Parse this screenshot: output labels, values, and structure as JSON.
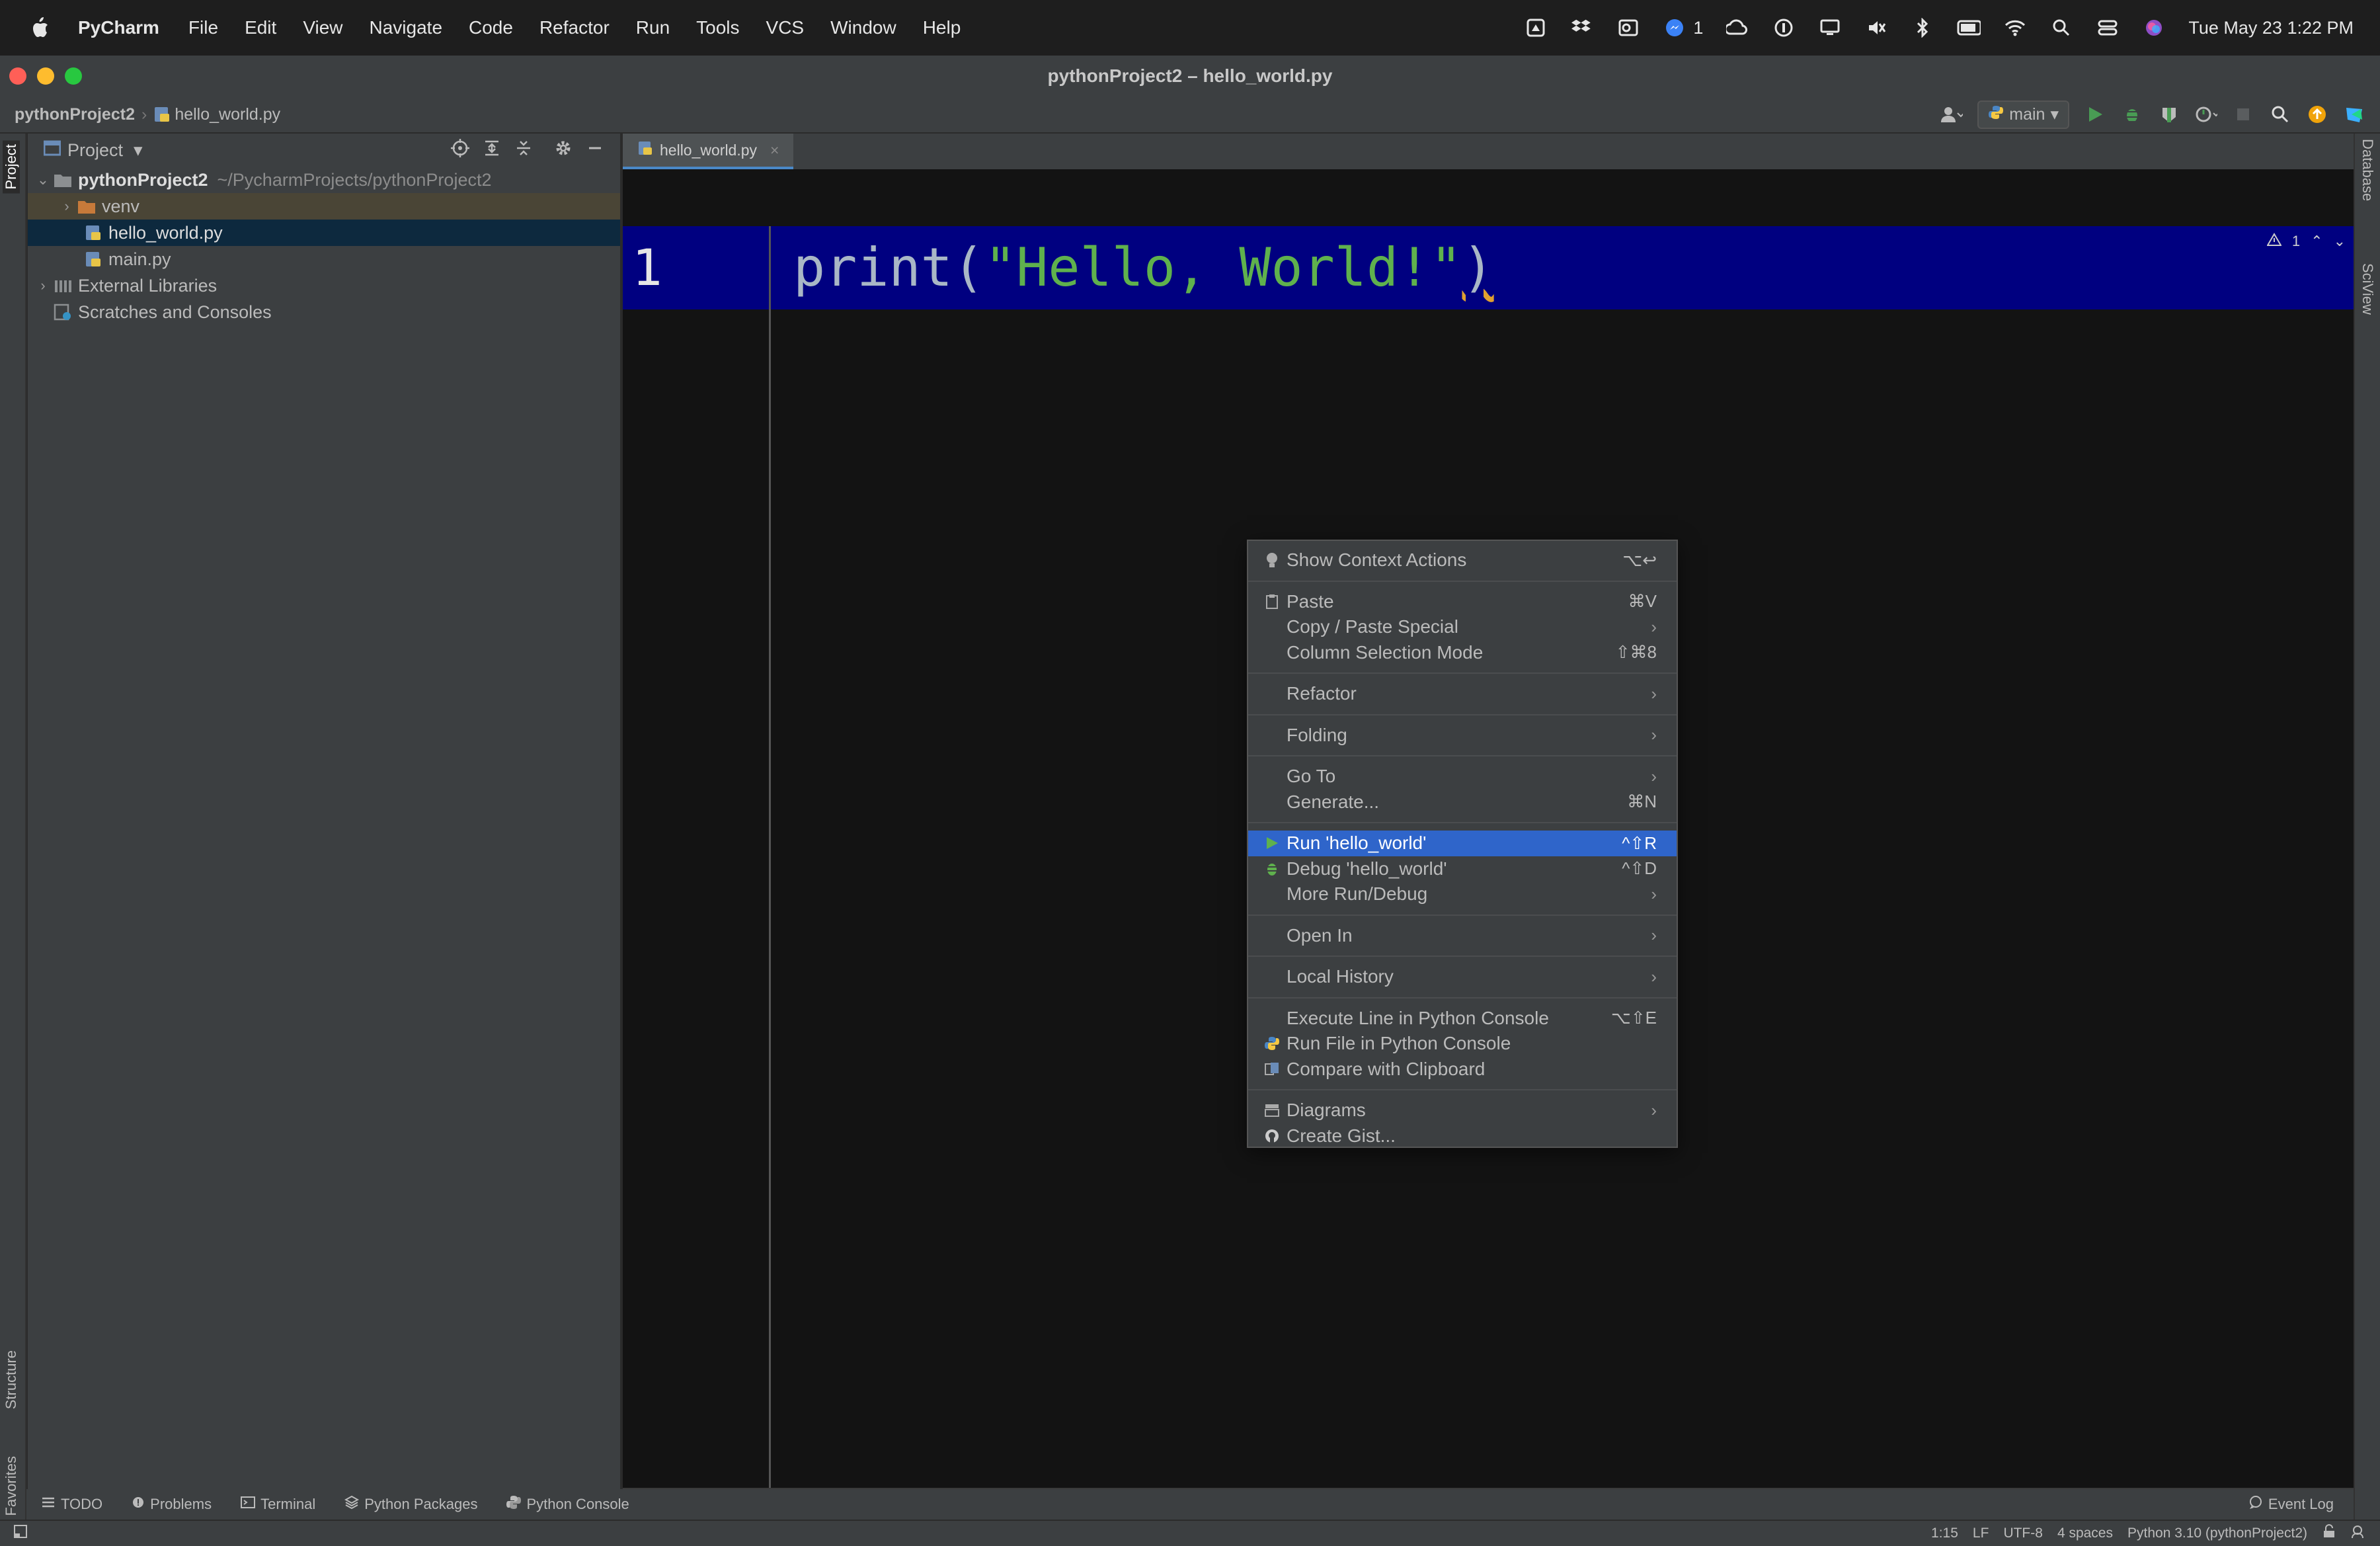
{
  "menubar": {
    "app_name": "PyCharm",
    "items": [
      "File",
      "Edit",
      "View",
      "Navigate",
      "Code",
      "Refactor",
      "Run",
      "Tools",
      "VCS",
      "Window",
      "Help"
    ],
    "notification_count": "1",
    "datetime": "Tue May 23  1:22 PM"
  },
  "window": {
    "title": "pythonProject2 – hello_world.py"
  },
  "navbar": {
    "project": "pythonProject2",
    "file": "hello_world.py",
    "branch": "main"
  },
  "project_panel": {
    "title": "Project",
    "root_name": "pythonProject2",
    "root_path": "~/PycharmProjects/pythonProject2",
    "items": [
      {
        "label": "venv"
      },
      {
        "label": "hello_world.py"
      },
      {
        "label": "main.py"
      },
      {
        "label": "External Libraries"
      },
      {
        "label": "Scratches and Consoles"
      }
    ]
  },
  "left_tabs": {
    "project": "Project",
    "structure": "Structure",
    "favorites": "Favorites"
  },
  "right_tabs": {
    "database": "Database",
    "sciview": "SciView"
  },
  "editor": {
    "tab_label": "hello_world.py",
    "line_number": "1",
    "code_fn": "print",
    "code_open": "(",
    "code_string": "\"Hello, World!\"",
    "code_close": ")",
    "warning_count": "1"
  },
  "context_menu": {
    "items": [
      {
        "label": "Show Context Actions",
        "shortcut": "⌥↩"
      },
      {
        "label": "Paste",
        "shortcut": "⌘V"
      },
      {
        "label": "Copy / Paste Special"
      },
      {
        "label": "Column Selection Mode",
        "shortcut": "⇧⌘8"
      },
      {
        "label": "Refactor"
      },
      {
        "label": "Folding"
      },
      {
        "label": "Go To"
      },
      {
        "label": "Generate...",
        "shortcut": "⌘N"
      },
      {
        "label": "Run 'hello_world'",
        "shortcut": "^⇧R"
      },
      {
        "label": "Debug 'hello_world'",
        "shortcut": "^⇧D"
      },
      {
        "label": "More Run/Debug"
      },
      {
        "label": "Open In"
      },
      {
        "label": "Local History"
      },
      {
        "label": "Execute Line in Python Console",
        "shortcut": "⌥⇧E"
      },
      {
        "label": "Run File in Python Console"
      },
      {
        "label": "Compare with Clipboard"
      },
      {
        "label": "Diagrams"
      },
      {
        "label": "Create Gist..."
      }
    ]
  },
  "bottom_tools": {
    "todo": "TODO",
    "problems": "Problems",
    "terminal": "Terminal",
    "python_packages": "Python Packages",
    "python_console": "Python Console",
    "event_log": "Event Log"
  },
  "status": {
    "position": "1:15",
    "line_sep": "LF",
    "encoding": "UTF-8",
    "indent": "4 spaces",
    "interpreter": "Python 3.10 (pythonProject2)"
  },
  "colors": {
    "accent": "#2f65ca",
    "string": "#5fb14d",
    "line_highlight": "#000080"
  }
}
